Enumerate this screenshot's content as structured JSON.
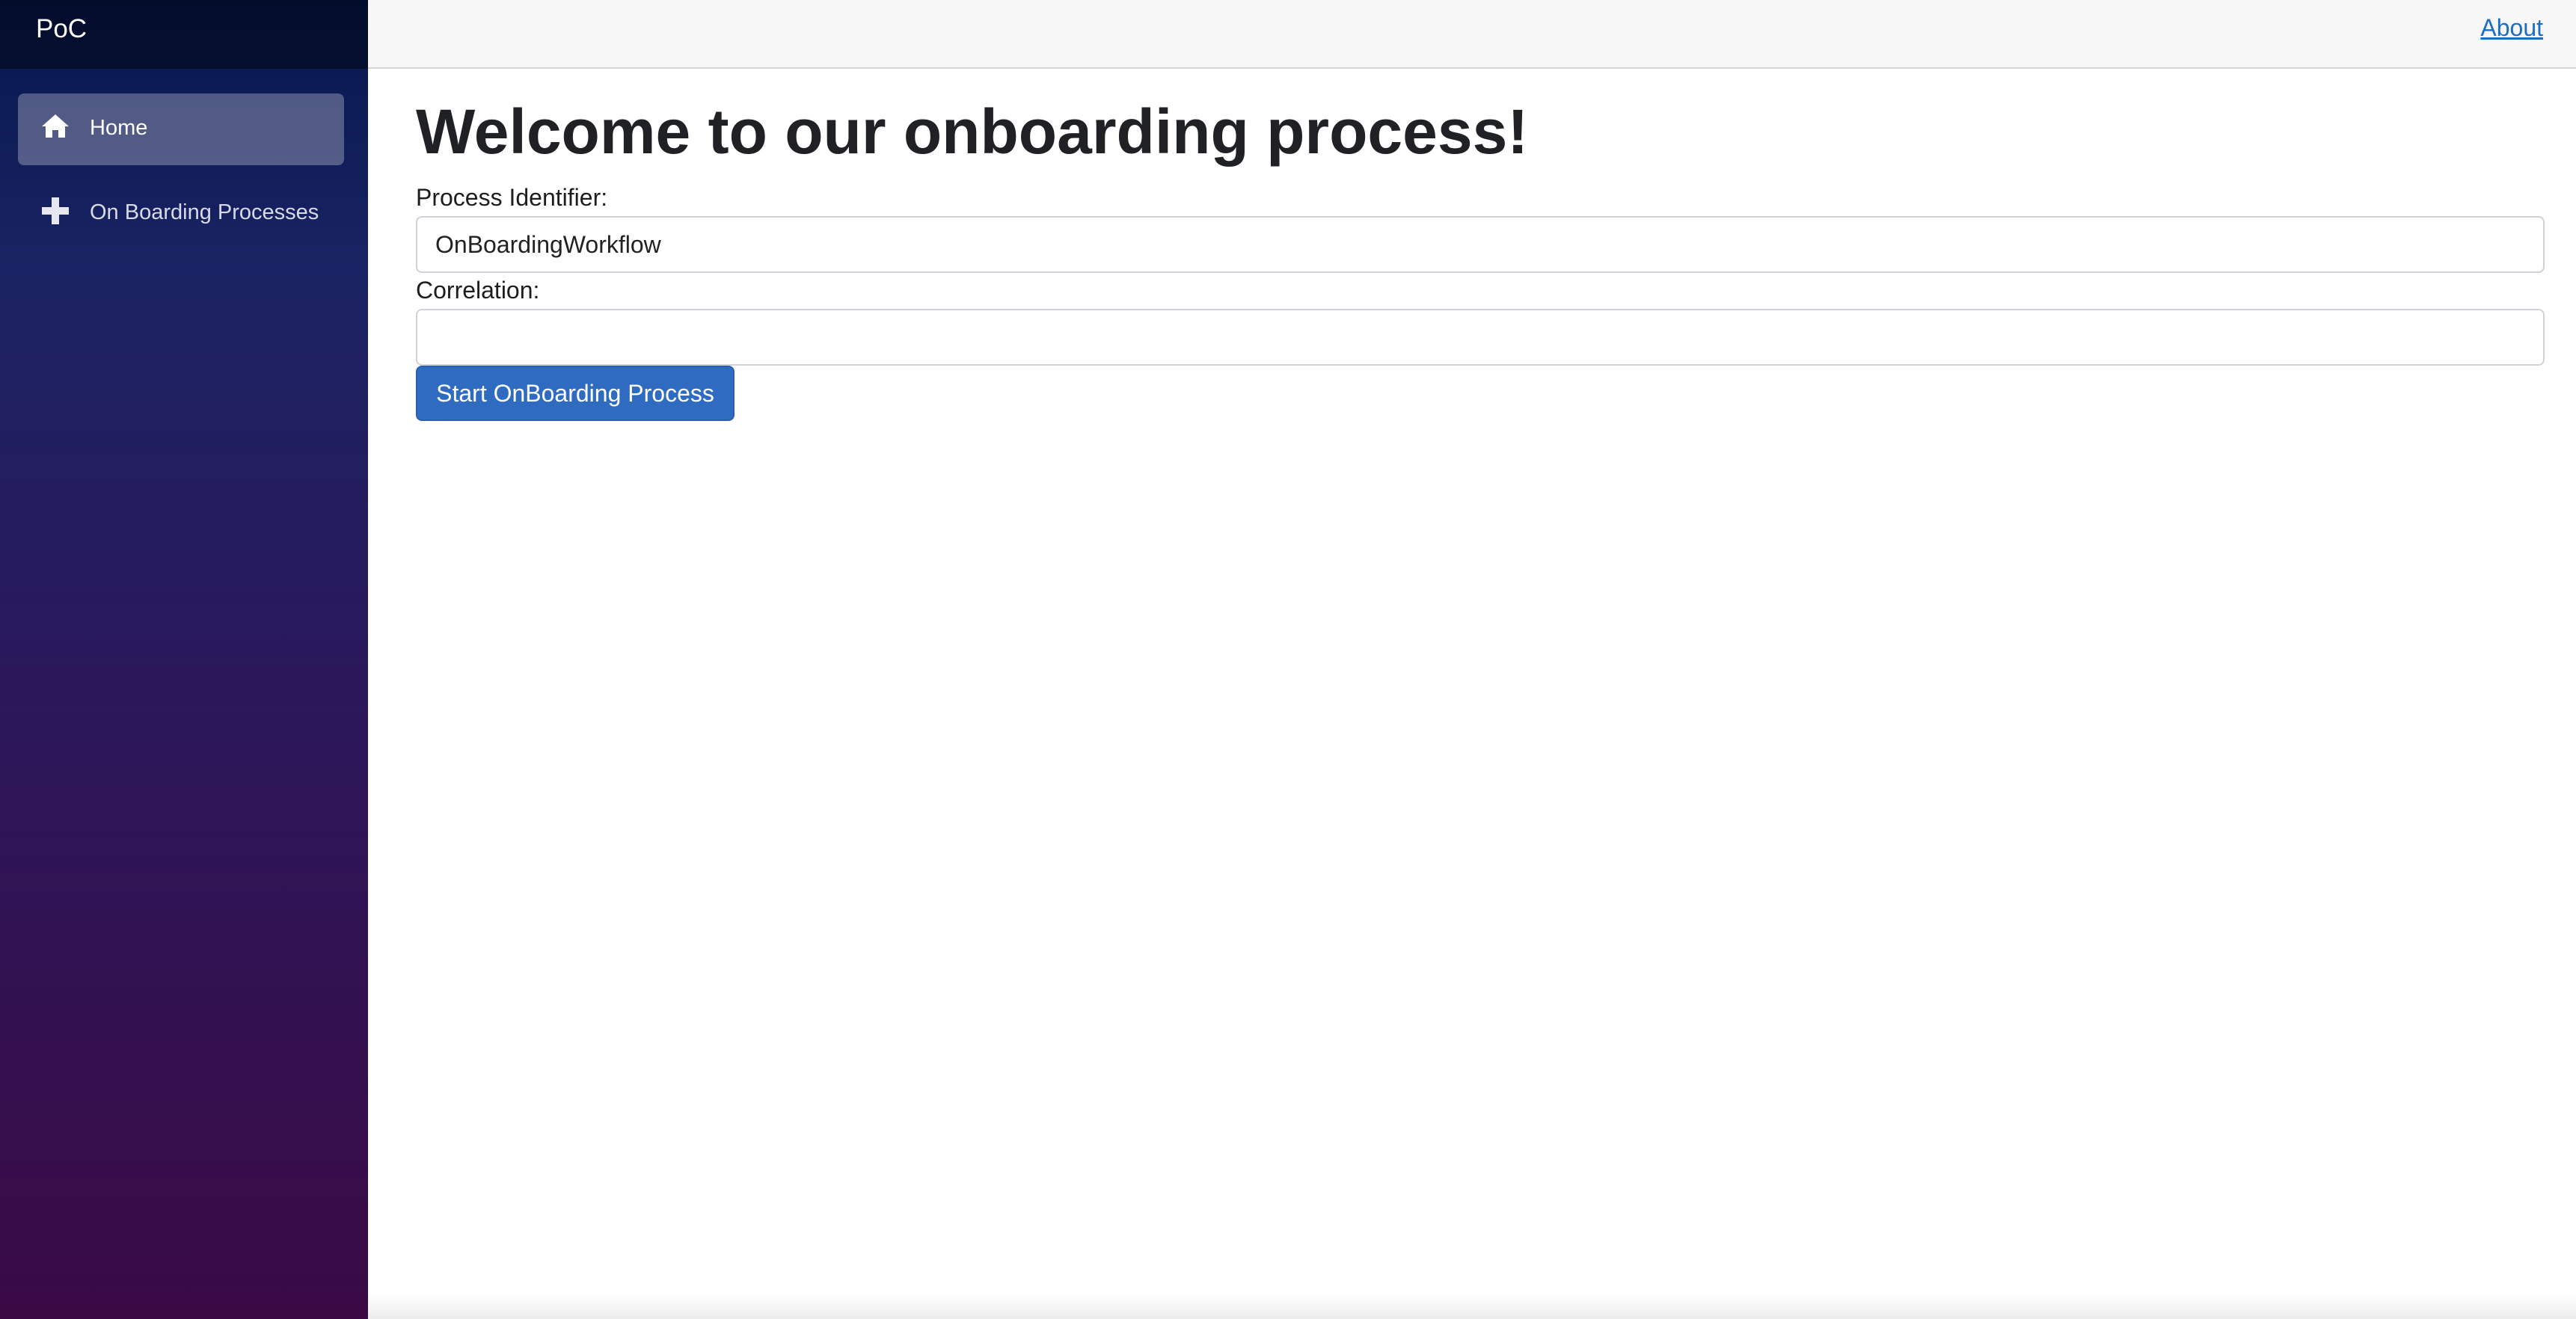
{
  "sidebar": {
    "brand": "PoC",
    "items": [
      {
        "label": "Home",
        "icon": "home-icon",
        "active": true
      },
      {
        "label": "On Boarding Processes",
        "icon": "plus-icon",
        "active": false
      }
    ]
  },
  "header": {
    "about_link": "About"
  },
  "main": {
    "title": "Welcome to our onboarding process!",
    "process_identifier": {
      "label": "Process Identifier:",
      "value": "OnBoardingWorkflow"
    },
    "correlation": {
      "label": "Correlation:",
      "value": ""
    },
    "start_button": "Start OnBoarding Process"
  },
  "colors": {
    "sidebar_top": "#05174d",
    "sidebar_bottom": "#3a0a45",
    "link": "#1b6ec2",
    "button": "#2f6cc1"
  }
}
